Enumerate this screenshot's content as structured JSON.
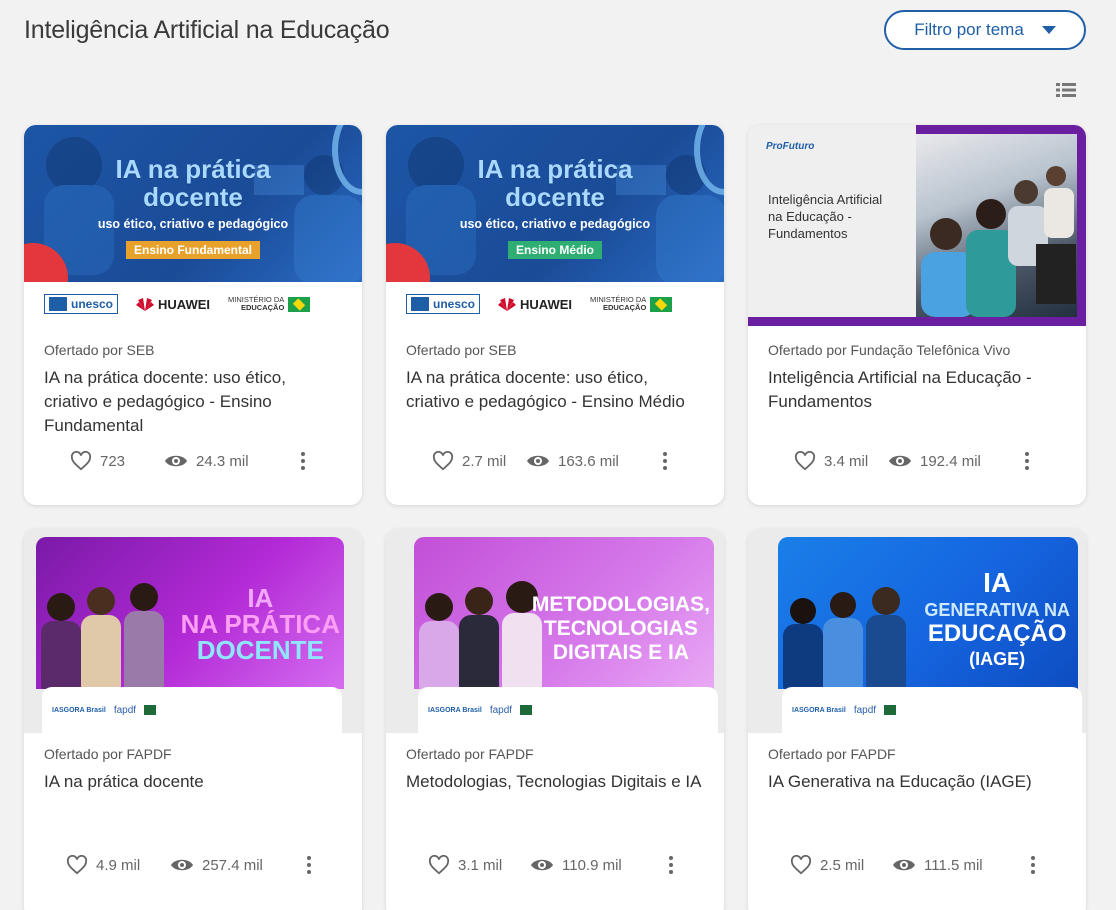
{
  "header": {
    "title": "Inteligência Artificial na Educação",
    "filter_label": "Filtro por tema"
  },
  "cards": [
    {
      "provider": "Ofertado por SEB",
      "title": "IA na prática docente: uso ético, criativo e pedagógico - Ensino Fundamental",
      "likes": "723",
      "views": "24.3 mil",
      "banner": {
        "headline_1": "IA na prática",
        "headline_2": "docente",
        "subtitle": "uso ético, criativo e pedagógico",
        "badge": "Ensino Fundamental",
        "badge_color": "#e8a22b",
        "logo_unesco": "unesco",
        "logo_huawei": "HUAWEI",
        "logo_mec_1": "MINISTÉRIO DA",
        "logo_mec_2": "EDUCAÇÃO"
      }
    },
    {
      "provider": "Ofertado por SEB",
      "title": "IA na prática docente: uso ético, criativo e pedagógico - Ensino Médio",
      "likes": "2.7 mil",
      "views": "163.6 mil",
      "banner": {
        "headline_1": "IA na prática",
        "headline_2": "docente",
        "subtitle": "uso ético, criativo e pedagógico",
        "badge": "Ensino Médio",
        "badge_color": "#2fae74",
        "logo_unesco": "unesco",
        "logo_huawei": "HUAWEI",
        "logo_mec_1": "MINISTÉRIO DA",
        "logo_mec_2": "EDUCAÇÃO"
      }
    },
    {
      "provider": "Ofertado por Fundação Telefônica Vivo",
      "title": "Inteligência Artificial na Educação - Fundamentos",
      "likes": "3.4 mil",
      "views": "192.4 mil",
      "banner": {
        "brand": "ProFuturo",
        "text": "Inteligência Artificial na Educação - Fundamentos"
      }
    },
    {
      "provider": "Ofertado por FAPDF",
      "title": "IA na prática docente",
      "likes": "4.9 mil",
      "views": "257.4 mil",
      "banner": {
        "line_1": "IA",
        "line_2": "NA PRÁTICA",
        "line_3": "DOCENTE",
        "logo_1": "IASGORA Brasil",
        "logo_2": "fapdf"
      }
    },
    {
      "provider": "Ofertado por FAPDF",
      "title": "Metodologias, Tecnologias Digitais e IA",
      "likes": "3.1 mil",
      "views": "110.9 mil",
      "banner": {
        "line_1": "METODOLOGIAS,",
        "line_2": "TECNOLOGIAS",
        "line_3": "DIGITAIS E IA",
        "logo_1": "IASGORA Brasil",
        "logo_2": "fapdf"
      }
    },
    {
      "provider": "Ofertado por FAPDF",
      "title": "IA Generativa na Educação (IAGE)",
      "likes": "2.5 mil",
      "views": "111.5 mil",
      "banner": {
        "line_1": "IA",
        "line_2": "GENERATIVA NA",
        "line_3": "EDUCAÇÃO",
        "line_4": "(IAGE)",
        "logo_1": "IASGORA Brasil",
        "logo_2": "fapdf"
      }
    }
  ],
  "icons": {
    "filter_caret": "caret-down-icon",
    "view_toggle": "list-view-icon",
    "like": "heart-icon",
    "views": "eye-icon",
    "more": "more-vertical-icon"
  },
  "colors": {
    "accent": "#1f5fa8",
    "background": "#f2f2f2",
    "purple_banner": "#a020c8",
    "blue_banner": "#1565e0"
  }
}
